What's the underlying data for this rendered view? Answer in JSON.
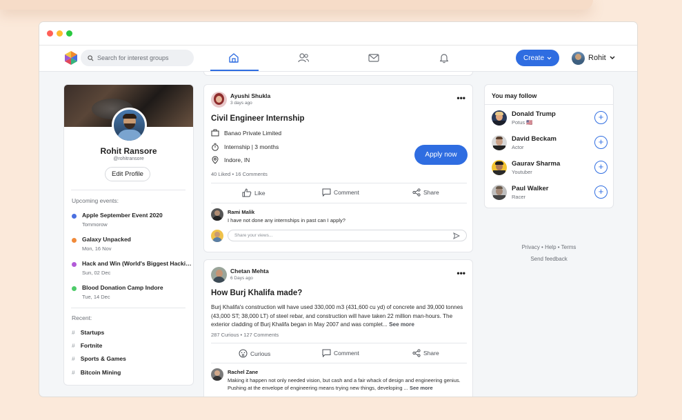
{
  "search": {
    "placeholder": "Search for interest groups"
  },
  "header": {
    "create_label": "Create",
    "user_name": "Rohit"
  },
  "profile": {
    "name": "Rohit Ransore",
    "handle": "@rohitransore",
    "edit_label": "Edit Profile"
  },
  "events": {
    "label": "Upcoming events:",
    "items": [
      {
        "title": "Apple September Event 2020",
        "date": "Tommorow",
        "color": "#4a6fe0"
      },
      {
        "title": "Galaxy Unpacked",
        "date": "Mon, 16 Nov",
        "color": "#f08a3a"
      },
      {
        "title": "Hack and Win (World's Biggest Hackin...",
        "date": "Sun, 02 Dec",
        "color": "#b25ad8"
      },
      {
        "title": "Blood Donation Camp Indore",
        "date": "Tue, 14 Dec",
        "color": "#4ecb6a"
      }
    ]
  },
  "recent": {
    "label": "Recent:",
    "items": [
      "Startups",
      "Fortnite",
      "Sports & Games",
      "Bitcoin Mining"
    ]
  },
  "post1": {
    "author": "Ayushi Shukla",
    "time": "3 days ago",
    "title": "Civil Engineer Internship",
    "company": "Banao Private Limited",
    "type": "Internship | 3 months",
    "location": "Indore, IN",
    "apply_label": "Apply now",
    "stats": "40 Liked • 16 Comments",
    "like_label": "Like",
    "comment_label": "Comment",
    "share_label": "Share",
    "comment": {
      "name": "Rami Malik",
      "text": "I have not done any internships in past can I apply?"
    },
    "input_placeholder": "Share your views..."
  },
  "post2": {
    "author": "Chetan Mehta",
    "time": "6 Days ago",
    "title": "How Burj Khalifa made?",
    "body": "Burj Khalifa's construction will have used 330,000 m3 (431,600 cu yd) of concrete and 39,000 tonnes (43,000 ST; 38,000 LT) of steel rebar, and construction will have taken 22 million man-hours. The exterior cladding of Burj Khalifa began in May 2007 and was complet...",
    "see_more": "See more",
    "stats": "287 Curious • 127 Comments",
    "curious_label": "Curious",
    "comment_label": "Comment",
    "share_label": "Share",
    "comment": {
      "name": "Rachel Zane",
      "text": "Making it happen not only needed vision, but cash and a fair whack of design and engineering genius. Pushing at the envelope of engineering means trying new things, developing ...",
      "see_more": "See more"
    }
  },
  "follow": {
    "title": "You may follow",
    "people": [
      {
        "name": "Donald Trump",
        "subtitle": "Potus 🇺🇸"
      },
      {
        "name": "David Beckam",
        "subtitle": "Actor"
      },
      {
        "name": "Gaurav Sharma",
        "subtitle": "Youtuber"
      },
      {
        "name": "Paul Walker",
        "subtitle": "Racer"
      }
    ]
  },
  "footer": {
    "links": "Privacy • Help • Terms",
    "feedback": "Send feedback"
  },
  "colors": {
    "accent": "#2f6de1",
    "background": "#fbe9da"
  }
}
